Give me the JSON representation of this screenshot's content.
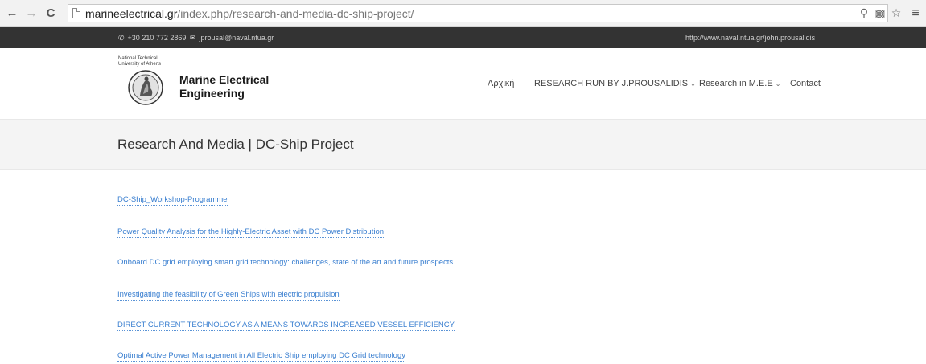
{
  "browser": {
    "url_host": "marineelectrical.gr",
    "url_path": "/index.php/research-and-media-dc-ship-project/"
  },
  "topbar": {
    "phone": "+30 210 772 2869",
    "email": "jprousal@naval.ntua.gr",
    "site": "http://www.naval.ntua.gr/john.prousalidis"
  },
  "header": {
    "university_line1": "National Technical",
    "university_line2": "University of Athens",
    "brand_line1": "Marine Electrical",
    "brand_line2": "Engineering",
    "nav": {
      "home": "Αρχική",
      "research_run": "RESEARCH RUN BY J.PROUSALIDIS",
      "research_mee": "Research in M.E.E",
      "contact": "Contact"
    }
  },
  "page": {
    "title": "Research And Media | DC-Ship Project"
  },
  "links": [
    "DC-Ship_Workshop-Programme",
    "Power Quality Analysis for the Highly-Electric Asset with DC Power Distribution",
    "Onboard DC grid employing smart grid technology: challenges, state of the art and future prospects",
    "Investigating the feasibility of Green Ships with electric propulsion",
    "DIRECT CURRENT TECHNOLOGY AS A MEANS TOWARDS INCREASED VESSEL EFFICIENCY",
    "Optimal Active Power Management in All Electric Ship employing DC Grid technology"
  ],
  "colors": {
    "topbar_bg": "#333333",
    "link": "#3a7fd0",
    "title_band_bg": "#f4f4f4"
  },
  "icons": {
    "back": "arrow-left-icon",
    "forward": "arrow-right-icon",
    "reload": "reload-icon",
    "page": "page-icon",
    "zoom": "magnifier-icon",
    "translate": "translate-icon",
    "bookmark": "star-icon",
    "menu": "hamburger-menu-icon",
    "phone": "phone-icon",
    "email": "envelope-icon"
  }
}
